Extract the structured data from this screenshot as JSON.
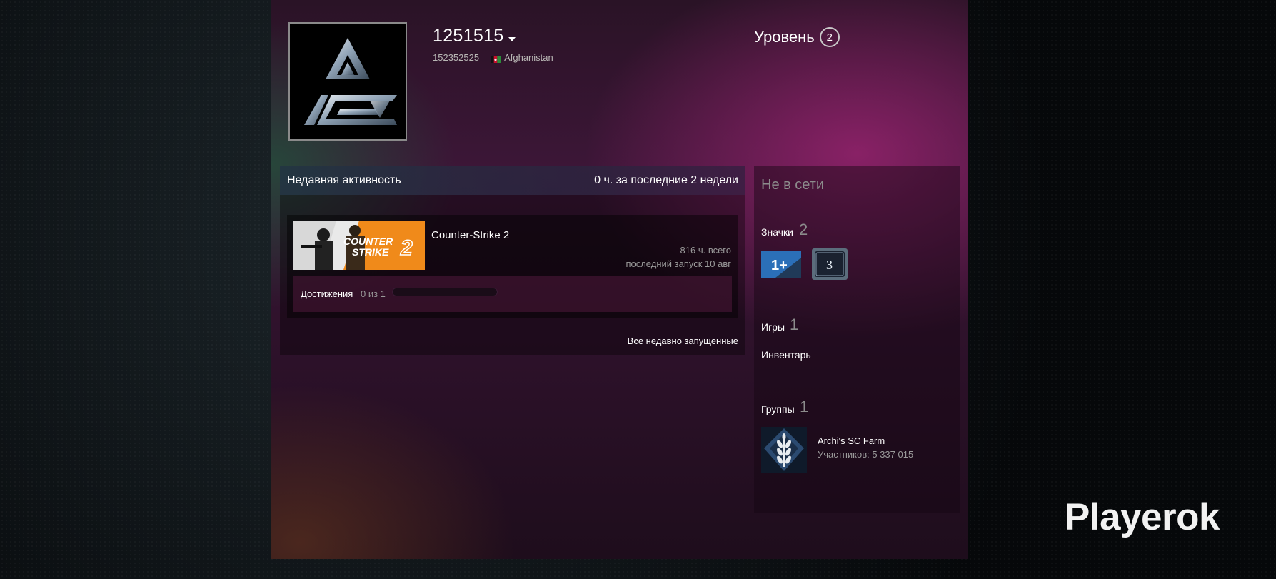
{
  "profile": {
    "persona_name": "1251515",
    "real_name": "152352525",
    "country": "Afghanistan",
    "level_label": "Уровень",
    "level_value": "2",
    "avatar_icon": "triangle-logo-avatar"
  },
  "activity": {
    "title": "Недавняя активность",
    "hours_summary": "0 ч. за последние 2 недели",
    "game": {
      "name": "Counter-Strike 2",
      "capsule_text_1": "COUNTER",
      "capsule_text_2": "STRIKE",
      "capsule_number": "2",
      "total_hours": "816 ч. всего",
      "last_played": "последний запуск 10 авг",
      "achievements_label": "Достижения",
      "achievements_count": "0 из 1",
      "achievements_progress": 0
    },
    "all_recent_link": "Все недавно запущенные"
  },
  "sidebar": {
    "status": "Не в сети",
    "badges_label": "Значки",
    "badges_count": "2",
    "badges": [
      {
        "text": "1+",
        "icon": "years-of-service-badge-icon"
      },
      {
        "text": "3",
        "icon": "level-badge-icon"
      }
    ],
    "games_label": "Игры",
    "games_count": "1",
    "inventory_label": "Инвентарь",
    "groups_label": "Группы",
    "groups_count": "1",
    "group": {
      "name": "Archi's SC Farm",
      "members": "Участников: 5 337 015",
      "icon": "wheat-icon"
    }
  },
  "watermark": "Playerok",
  "colors": {
    "accent_magenta": "#962370",
    "text_muted": "#8c8c8c",
    "cs2_orange": "#f08a1a"
  }
}
